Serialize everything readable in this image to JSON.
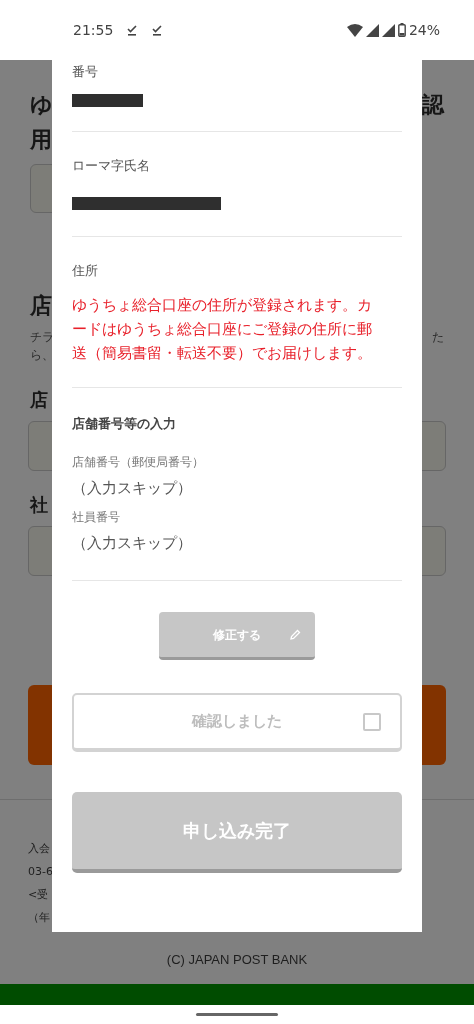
{
  "status_bar": {
    "time": "21:55",
    "battery": "24%"
  },
  "background_page": {
    "heading_left": "ゆ",
    "heading_right": "認",
    "heading_line2": "用",
    "section_title": "店",
    "note_left_1": "チラ",
    "note_right": "た",
    "note_left_2": "ら、",
    "field_label_1": "店",
    "field_label_2": "社",
    "contact_lines": [
      "入会",
      "03-6",
      "<受",
      "（年"
    ],
    "copyright": "(C) JAPAN POST BANK"
  },
  "modal": {
    "fields": [
      {
        "label": "番号",
        "kind": "redacted"
      },
      {
        "label": "ローマ字氏名",
        "kind": "redacted"
      },
      {
        "label": "住所",
        "kind": "notice",
        "text": "ゆうちょ総合口座の住所が登録されます。カードはゆうちょ総合口座にご登録の住所に郵送（簡易書留・転送不要）でお届けします。"
      }
    ],
    "store_section": {
      "title": "店舗番号等の入力",
      "items": [
        {
          "label": "店舗番号（郵便局番号）",
          "value": "（入力スキップ）"
        },
        {
          "label": "社員番号",
          "value": "（入力スキップ）"
        }
      ]
    },
    "edit_button": {
      "label": "修正する",
      "disabled": true
    },
    "confirm": {
      "label": "確認しました",
      "checked": false
    },
    "submit_button": {
      "label": "申し込み完了",
      "disabled": true
    }
  }
}
